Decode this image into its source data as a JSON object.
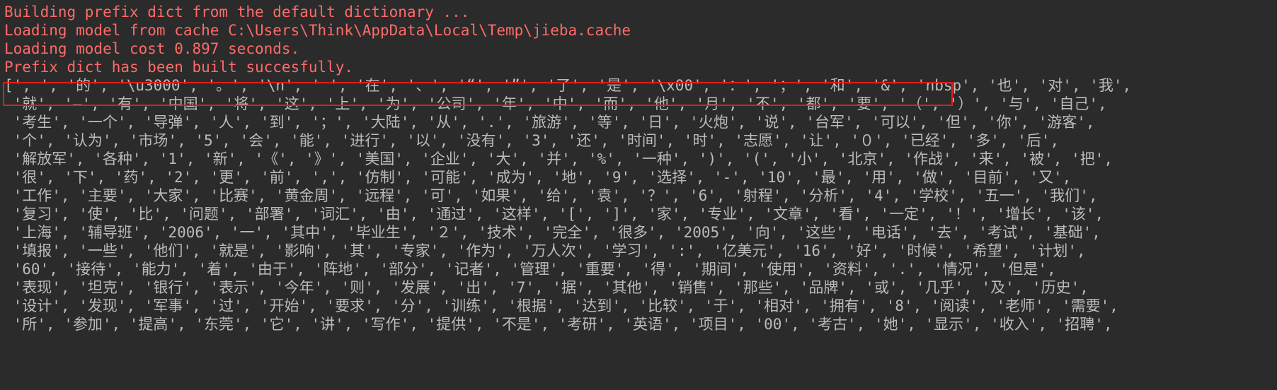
{
  "console": {
    "stderr_lines": [
      "Building prefix dict from the default dictionary ...",
      "Loading model from cache C:\\Users\\Think\\AppData\\Local\\Temp\\jieba.cache",
      "Loading model cost 0.897 seconds.",
      "Prefix dict has been built succesfully."
    ],
    "output_lines": [
      "[', ', '的', '\\u3000', '。', '\\n', ' ', '在', '、', '“', '”', '了', '是', '\\x00', '：', '；', '和', '&', 'nbsp', '也', '对', '我',",
      " '就', '—', '有', '中国', '将', '这', '上', '为', '公司', '年', '中', '而', '他', '月', '不', '都', '要', '（', '）', '与', '自己',",
      " '考生', '一个', '导弹', '人', '到', '；', '大陆', '从', '.', '旅游', '等', '日', '火炮', '说', '台军', '可以', '但', '你', '游客',",
      " '个', '认为', '市场', '5', '会', '能', '进行', '以', '没有', '3', '还', '时间', '时', '志愿', '让', '０', '已经', '多', '后',",
      " '解放军', '各种', '1', '新', '《', '》', '美国', '企业', '大', '并', '%', '一种', ')', '(', '小', '北京', '作战', '来', '被', '把',",
      " '很', '下', '药', '2', '更', '前', ',', '仿制', '可能', '成为', '地', '9', '选择', '-', '10', '最', '用', '做', '目前', '又',",
      " '工作', '主要', '大家', '比赛', '黄金周', '远程', '可', '如果', '给', '袁', '？', '6', '射程', '分析', '4', '学校', '五一', '我们',",
      " '复习', '使', '比', '问题', '部署', '词汇', '由', '通过', '这样', '[', ']', '家', '专业', '文章', '看', '一定', '！', '增长', '该',",
      " '上海', '辅导班', '2006', '一', '其中', '毕业生', '２', '技术', '完全', '很多', '2005', '向', '这些', '电话', '去', '考试', '基础',",
      " '填报', '一些', '他们', '就是', '影响', '其', '专家', '作为', '万人次', '学习', ':', '亿美元', '16', '好', '时候', '希望', '计划',",
      " '60', '接待', '能力', '着', '由于', '阵地', '部分', '记者', '管理', '重要', '得', '期间', '使用', '资料', '.', '情况', '但是',",
      " '表现', '坦克', '银行', '表示', '今年', '则', '发展', '出', '7', '据', '其他', '销售', '那些', '品牌', '或', '几乎', '及', '历史',",
      " '设计', '发现', '军事', '过', '开始', '要求', '分', '训练', '根据', '达到', '比较', '于', '相对', '拥有', '8', '阅读', '老师', '需要',",
      " '所', '参加', '提高', '东莞', '它', '讲', '写作', '提供', '不是', '考研', '英语', '项目', '00', '考古', '她', '显示', '收入', '招聘',"
    ]
  }
}
